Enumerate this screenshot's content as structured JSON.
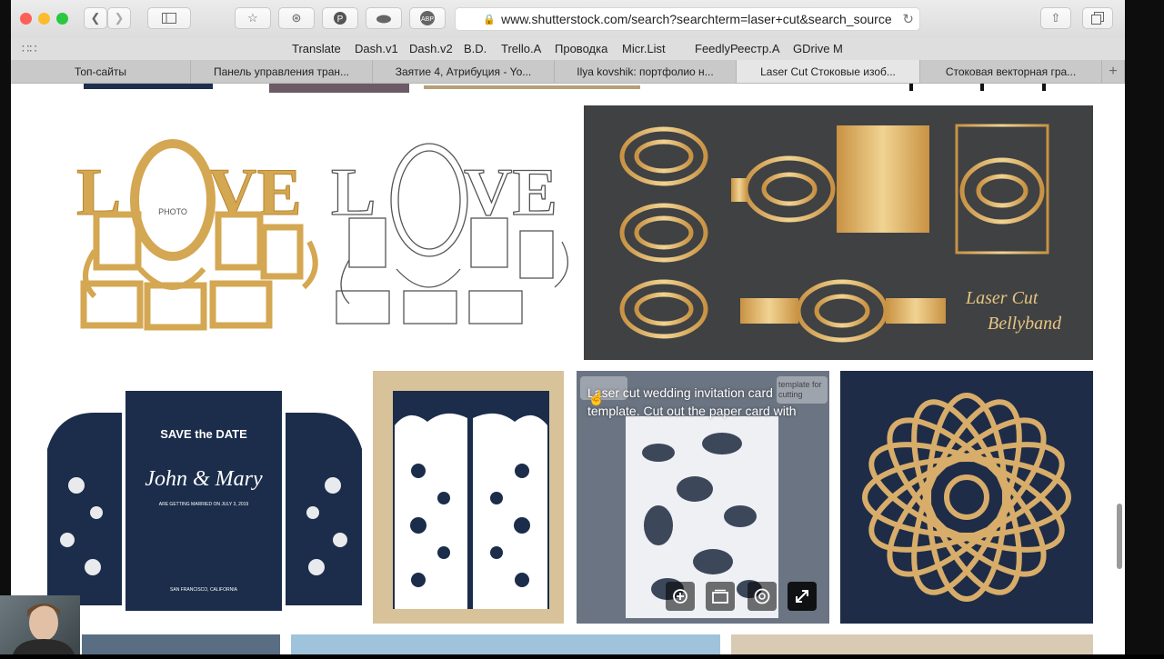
{
  "browser": {
    "url": "www.shutterstock.com/search?searchterm=laser+cut&search_source",
    "bookmarks": [
      "Translate",
      "Dash.v1",
      "Dash.v2",
      "B.D.",
      "Trello.A",
      "Проводка",
      "Micr.List",
      "Feedly",
      "Реестр.А",
      "GDrive M"
    ],
    "tabs": [
      {
        "label": "Топ-сайты",
        "active": false
      },
      {
        "label": "Панель управления тран...",
        "active": false
      },
      {
        "label": "Заятие 4, Атрибуция - Yo...",
        "active": false
      },
      {
        "label": "Ilya kovshik: портфолио н...",
        "active": false
      },
      {
        "label": "Laser Cut Стоковые изоб...",
        "active": true
      },
      {
        "label": "Стоковая векторная гра...",
        "active": false
      }
    ]
  },
  "images": {
    "love_frame": {
      "word": "LOVE",
      "photo_label": "PHOTO"
    },
    "bellyband": {
      "line1": "Laser Cut",
      "line2": "Bellyband"
    },
    "save_the_date": {
      "title": "SAVE the DATE",
      "names": "John & Mary",
      "subtitle": "ARE GETTING MARRIED ON JULY 3, 2019",
      "location": "SAN FRANCISCO, CALIFORNIA"
    },
    "hover_card": {
      "description": "Laser cut wedding invitation card template. Cut out the paper card with",
      "corner_tag": "template for cutting"
    }
  },
  "colors": {
    "gold": "#d4a752",
    "navy": "#1b2d4a",
    "dark_gray": "#3f4143",
    "beige": "#d8c29a"
  }
}
